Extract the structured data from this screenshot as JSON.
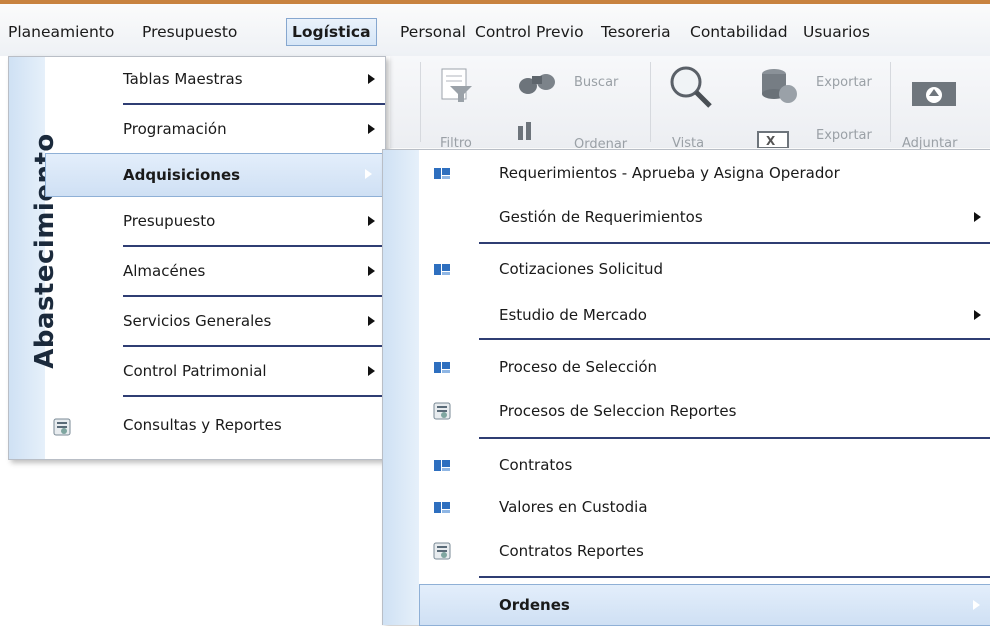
{
  "menubar": {
    "items": [
      "Planeamiento",
      "Presupuesto",
      "Logística",
      "Personal",
      "Control Previo",
      "Tesoreria",
      "Contabilidad",
      "Usuarios"
    ],
    "active": "Logística"
  },
  "ribbon": {
    "buscar": "Buscar",
    "exportar1": "Exportar",
    "exportar2": "Exportar",
    "filtro": "Filtro",
    "ordenar": "Ordenar",
    "vista": "Vista",
    "adjuntar": "Adjuntar"
  },
  "menu1": {
    "side_title": "Abastecimiento",
    "items": [
      {
        "label": "Tablas Maestras",
        "arrow": true
      },
      {
        "label": "Programación",
        "arrow": true
      },
      {
        "label": "Adquisiciones",
        "arrow": true,
        "highlighted": true
      },
      {
        "label": "Presupuesto",
        "arrow": true
      },
      {
        "label": "Almacénes",
        "arrow": true
      },
      {
        "label": "Servicios Generales",
        "arrow": true
      },
      {
        "label": "Control Patrimonial",
        "arrow": true
      },
      {
        "label": "Consultas y Reportes",
        "arrow": false,
        "icon": "report-icon"
      }
    ]
  },
  "menu2": {
    "items": [
      {
        "label": "Requerimientos - Aprueba y Asigna Operador",
        "icon": "form-icon"
      },
      {
        "label": "Gestión de Requerimientos",
        "arrow": true
      },
      {
        "label": "Cotizaciones Solicitud",
        "icon": "form-icon"
      },
      {
        "label": "Estudio de Mercado",
        "arrow": true
      },
      {
        "label": "Proceso de Selección",
        "icon": "form-icon"
      },
      {
        "label": "Procesos de Seleccion Reportes",
        "icon": "report-icon"
      },
      {
        "label": "Contratos",
        "icon": "form-icon"
      },
      {
        "label": "Valores en Custodia",
        "icon": "form-icon"
      },
      {
        "label": "Contratos Reportes",
        "icon": "report-icon"
      },
      {
        "label": "Ordenes",
        "arrow": true,
        "highlighted": true
      }
    ]
  },
  "colors": {
    "accent_border": "#86a7cf",
    "separator": "#2f3d73",
    "highlight_bg": "#d6e6f7",
    "top_line": "#c8823f"
  }
}
